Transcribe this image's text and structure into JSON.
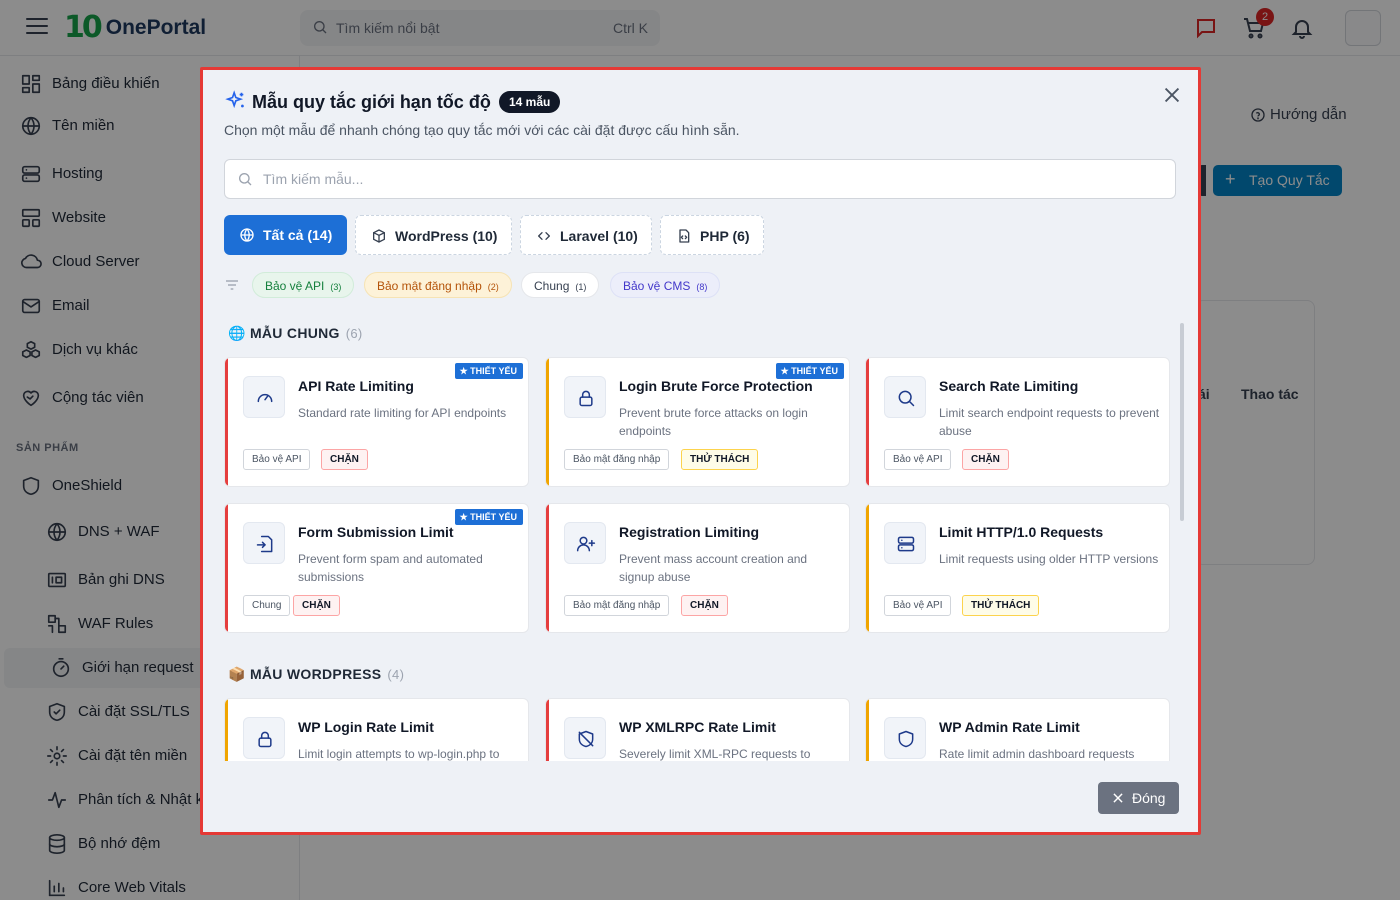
{
  "app": {
    "brand_mark": "10",
    "brand_name": "OnePortal",
    "search_placeholder": "Tìm kiếm nổi bật",
    "search_shortcut": "Ctrl K",
    "cart_badge": "2"
  },
  "sidebar": {
    "items": [
      {
        "label": "Bảng điều khiển",
        "icon": "dashboard-icon"
      },
      {
        "label": "Tên miền",
        "icon": "globe-icon"
      },
      {
        "label": "Hosting",
        "icon": "server-icon"
      },
      {
        "label": "Website",
        "icon": "layout-icon"
      },
      {
        "label": "Cloud Server",
        "icon": "cloud-icon"
      },
      {
        "label": "Email",
        "icon": "mail-icon"
      },
      {
        "label": "Dịch vụ khác",
        "icon": "boxes-icon"
      },
      {
        "label": "Cộng tác viên",
        "icon": "heart-handshake-icon"
      }
    ],
    "section_label": "SẢN PHẨM",
    "product": {
      "label": "OneShield",
      "icon": "shield-icon"
    },
    "sub_items": [
      {
        "label": "DNS + WAF",
        "icon": "globe-icon"
      },
      {
        "label": "Bản ghi DNS",
        "icon": "records-icon"
      },
      {
        "label": "WAF Rules",
        "icon": "waf-icon"
      },
      {
        "label": "Giới hạn request",
        "icon": "timer-icon"
      },
      {
        "label": "Cài đặt SSL/TLS",
        "icon": "shield-check-icon"
      },
      {
        "label": "Cài đặt tên miền",
        "icon": "settings-icon"
      },
      {
        "label": "Phân tích & Nhật ký",
        "icon": "activity-icon"
      },
      {
        "label": "Bộ nhớ đệm",
        "icon": "database-icon"
      },
      {
        "label": "Core Web Vitals",
        "icon": "bar-chart-icon"
      }
    ]
  },
  "main": {
    "guide_label": "Hướng dẫn",
    "create_label": "Tạo Quy Tắc",
    "table_header_action": "Thao tác",
    "table_header_partial": "ái"
  },
  "modal": {
    "title": "Mẫu quy tắc giới hạn tốc độ",
    "count_badge": "14 mẫu",
    "subtitle": "Chọn một mẫu để nhanh chóng tạo quy tắc mới với các cài đặt được cấu hình sẵn.",
    "search_placeholder": "Tìm kiếm mẫu...",
    "search_value": "",
    "tabs": [
      {
        "label": "Tất cả",
        "count": "(14)",
        "icon": "globe-icon",
        "active": true
      },
      {
        "label": "WordPress",
        "count": "(10)",
        "icon": "box-icon",
        "active": false
      },
      {
        "label": "Laravel",
        "count": "(10)",
        "icon": "code-icon",
        "active": false
      },
      {
        "label": "PHP",
        "count": "(6)",
        "icon": "file-code-icon",
        "active": false
      }
    ],
    "chips": [
      {
        "label": "Bảo vệ API",
        "count": "(3)"
      },
      {
        "label": "Bảo mật đăng nhập",
        "count": "(2)"
      },
      {
        "label": "Chung",
        "count": "(1)"
      },
      {
        "label": "Bảo vệ CMS",
        "count": "(8)"
      }
    ],
    "sections": [
      {
        "emoji": "🌐",
        "title": "MẪU CHUNG",
        "count": "(6)",
        "cards": [
          {
            "title": "API Rate Limiting",
            "desc": "Standard rate limiting for API endpoints",
            "category": "Bảo vệ API",
            "action": "CHẶN",
            "essential": "THIẾT YẾU",
            "icon": "gauge-icon",
            "accent": "#e53e3e"
          },
          {
            "title": "Login Brute Force Protection",
            "desc": "Prevent brute force attacks on login endpoints",
            "category": "Bảo mật đăng nhập",
            "action": "THỬ THÁCH",
            "essential": "THIẾT YẾU",
            "icon": "lock-icon",
            "accent": "#f0a500"
          },
          {
            "title": "Search Rate Limiting",
            "desc": "Limit search endpoint requests to prevent abuse",
            "category": "Bảo vệ API",
            "action": "CHẶN",
            "essential": "",
            "icon": "search-icon",
            "accent": "#e53e3e"
          },
          {
            "title": "Form Submission Limit",
            "desc": "Prevent form spam and automated submissions",
            "category": "Chung",
            "action": "CHẶN",
            "essential": "THIẾT YẾU",
            "icon": "file-input-icon",
            "accent": "#e53e3e"
          },
          {
            "title": "Registration Limiting",
            "desc": "Prevent mass account creation and signup abuse",
            "category": "Bảo mật đăng nhập",
            "action": "CHẶN",
            "essential": "",
            "icon": "user-plus-icon",
            "accent": "#e53e3e"
          },
          {
            "title": "Limit HTTP/1.0 Requests",
            "desc": "Limit requests using older HTTP versions",
            "category": "Bảo vệ API",
            "action": "THỬ THÁCH",
            "essential": "",
            "icon": "server-icon",
            "accent": "#f0a500"
          }
        ]
      },
      {
        "emoji": "📦",
        "title": "MẪU WORDPRESS",
        "count": "(4)",
        "cards": [
          {
            "title": "WP Login Rate Limit",
            "desc": "Limit login attempts to wp-login.php to",
            "icon": "lock-icon",
            "accent": "#f0a500"
          },
          {
            "title": "WP XMLRPC Rate Limit",
            "desc": "Severely limit XML-RPC requests to",
            "icon": "shield-off-icon",
            "accent": "#e53e3e"
          },
          {
            "title": "WP Admin Rate Limit",
            "desc": "Rate limit admin dashboard requests",
            "icon": "shield-icon",
            "accent": "#f0a500"
          }
        ]
      }
    ],
    "close_label": "Đóng"
  }
}
